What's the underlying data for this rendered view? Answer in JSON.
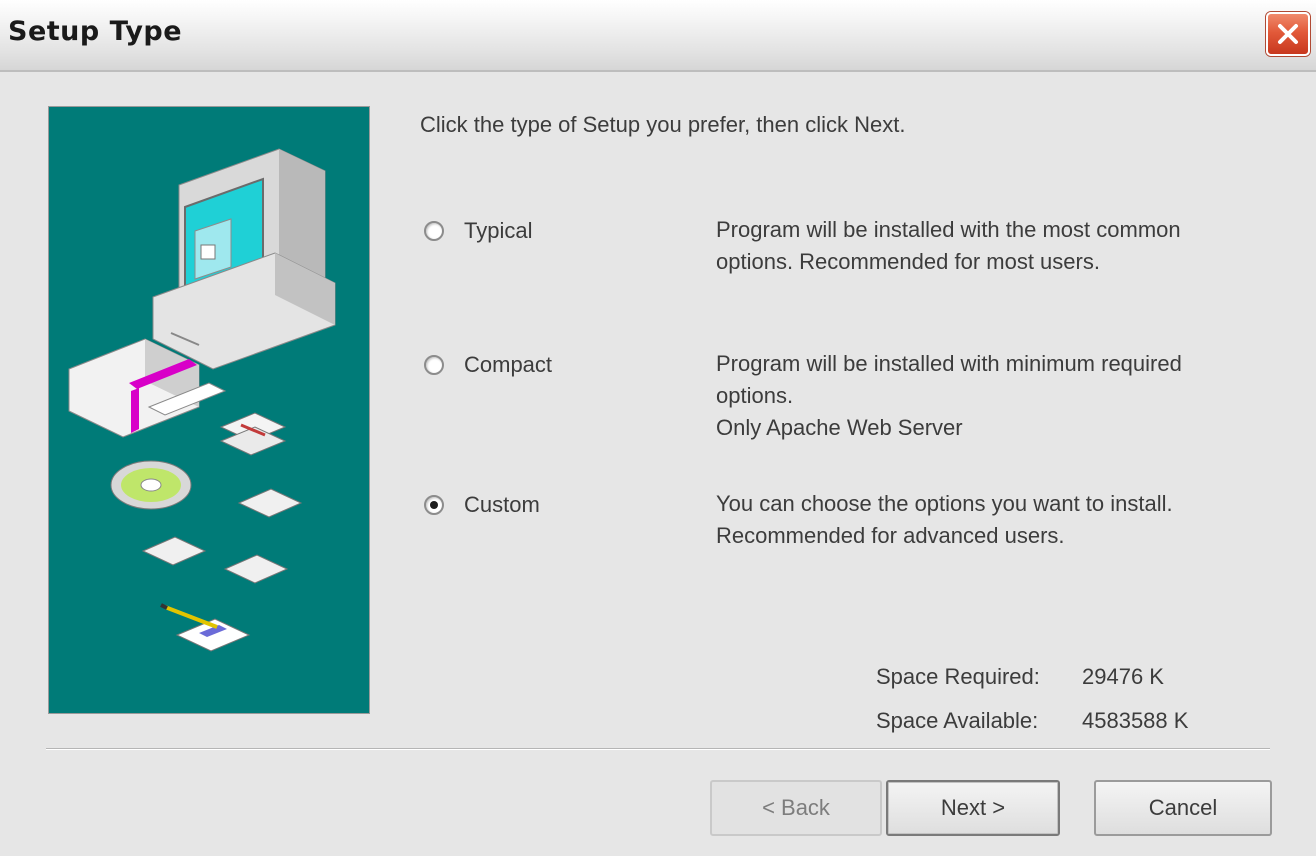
{
  "window": {
    "title": "Setup Type",
    "close_icon": "close-icon"
  },
  "instruction": "Click the type of Setup you prefer, then click Next.",
  "options": [
    {
      "label": "Typical",
      "selected": false,
      "description": [
        "Program will be installed with the most common",
        "options. Recommended for most users."
      ]
    },
    {
      "label": "Compact",
      "selected": false,
      "description": [
        "Program will be installed with minimum required",
        "options.",
        "Only Apache Web Server"
      ]
    },
    {
      "label": "Custom",
      "selected": true,
      "description": [
        "You can choose the options you want to install.",
        "Recommended for advanced users."
      ]
    }
  ],
  "space": {
    "required_label": "Space Required:",
    "required_value": "29476 K",
    "available_label": "Space Available:",
    "available_value": "4583588 K"
  },
  "buttons": {
    "back": "< Back",
    "next": "Next >",
    "cancel": "Cancel"
  },
  "colors": {
    "illustration_bg": "#007b78",
    "close_button": "#e25a3a"
  }
}
